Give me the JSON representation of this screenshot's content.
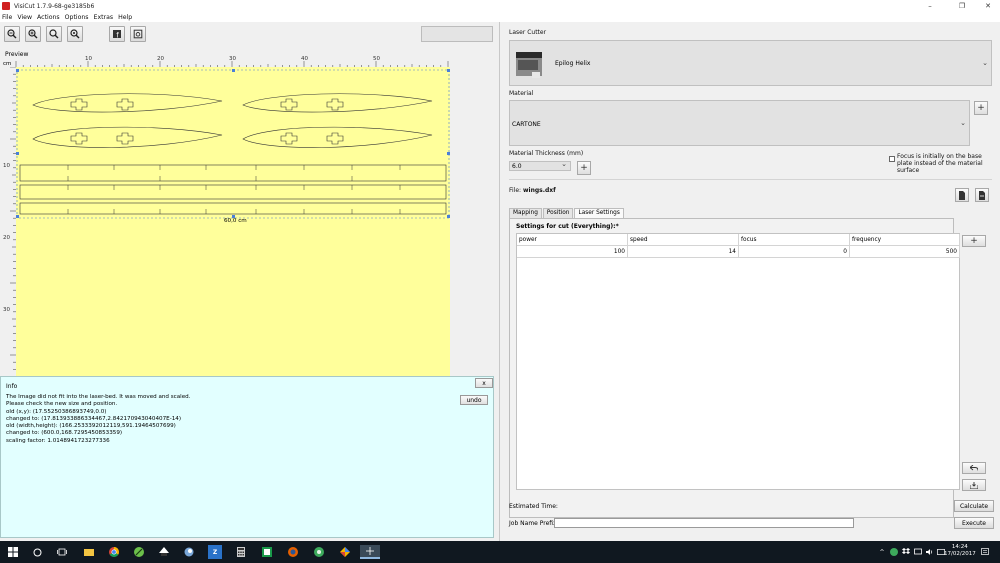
{
  "window": {
    "title": "VisiCut 1.7.9-68-ge3185b6",
    "controls": [
      "–",
      "❐",
      "✕"
    ]
  },
  "menu": [
    "File",
    "View",
    "Actions",
    "Options",
    "Extras",
    "Help"
  ],
  "preview": {
    "label": "Preview",
    "unit": "cm",
    "top_ticks": [
      "10",
      "20",
      "30",
      "40",
      "50"
    ],
    "left_ticks": [
      "10",
      "20",
      "30"
    ],
    "dimension_label": "60,0 cm"
  },
  "info": {
    "title": "Info",
    "close_label": "x",
    "undo_label": "undo",
    "lines": [
      "The Image did not fit into the laser-bed. It was moved and scaled.",
      "Please check the new size and position.",
      "old (x,y): (17.55250386893749,0.0)",
      "changed to: (17.813933886334467,2.842170943040407E-14)",
      "old (width,height): (166.2533392012119,591.19464507699)",
      "changed to: (600.0,168.7295450853359)",
      " scaling factor: 1.0148941723277336"
    ]
  },
  "laser_cutter": {
    "label": "Laser Cutter",
    "value": "Epilog Helix"
  },
  "material": {
    "label": "Material",
    "value": "CARTONE",
    "add_label": "+"
  },
  "thickness": {
    "label": "Material Thickness (mm)",
    "value": "6.0",
    "add_label": "+",
    "focus_note": "Focus is initially on the base plate instead of the material surface"
  },
  "file": {
    "label": "File:",
    "name": "wings.dxf"
  },
  "tabs": [
    "Mapping",
    "Position",
    "Laser Settings"
  ],
  "settings": {
    "title": "Settings for cut (Everything):*",
    "columns": [
      "power",
      "speed",
      "focus",
      "frequency"
    ],
    "rows": [
      [
        "100",
        "14",
        "0",
        "500"
      ]
    ],
    "add_label": "+"
  },
  "estimated_time": {
    "label": "Estimated Time:",
    "button": "Calculate"
  },
  "job_name": {
    "label": "Job Name Prefix:",
    "value": "",
    "button": "Execute"
  },
  "taskbar": {
    "time": "14:24",
    "date": "17/02/2017"
  },
  "colors": {
    "canvas": "#ffff9b",
    "info_bg": "#e2ffff",
    "taskbar": "#101820"
  }
}
